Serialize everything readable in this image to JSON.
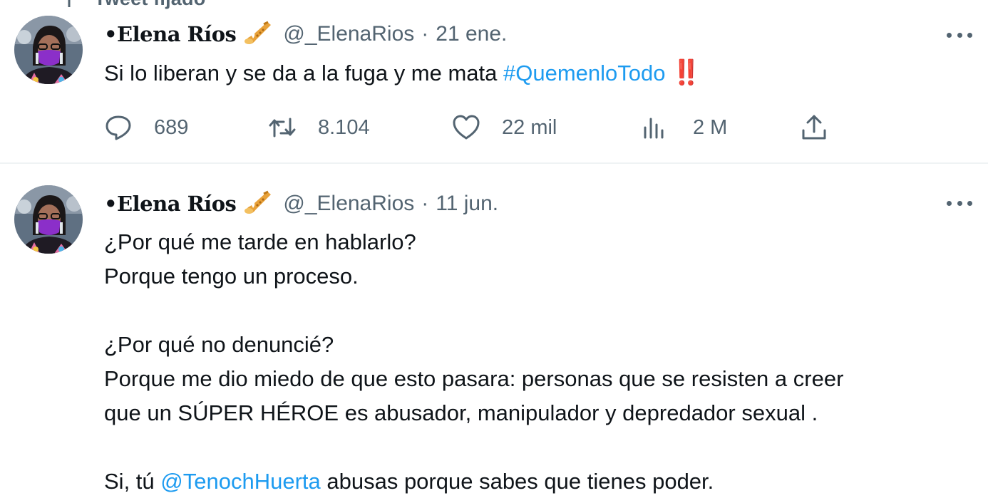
{
  "pinned": {
    "label": "Tweet fijado"
  },
  "tweets": [
    {
      "display_name": "•Elena Ríos",
      "handle": "@_ElenaRios",
      "separator": "·",
      "date": "21 ene.",
      "text": {
        "part1": "Si lo liberan y se da a la fuga y me mata ",
        "hashtag": "#QuemenloTodo",
        "emoji": "‼️"
      },
      "stats": {
        "replies": "689",
        "retweets": "8.104",
        "likes": "22 mil",
        "views": "2 M"
      }
    },
    {
      "display_name": "•Elena Ríos",
      "handle": "@_ElenaRios",
      "separator": "·",
      "date": "11 jun.",
      "lines": [
        "¿Por qué me tarde en hablarlo?",
        "Porque tengo un proceso.",
        "",
        "¿Por qué no denuncié?",
        "Porque me dio miedo de que esto pasara: personas que se resisten a creer",
        "que un SÚPER HÉROE es abusador, manipulador y depredador sexual .",
        ""
      ],
      "last_line": {
        "prefix": "Si, tú ",
        "mention": "@TenochHuerta",
        "suffix": " abusas porque sabes que tienes poder."
      }
    }
  ],
  "icons": {
    "pin": "pin-icon",
    "name_emoji": "saxophone-emoji-icon",
    "more": "more-options-icon",
    "reply": "reply-icon",
    "retweet": "retweet-icon",
    "like": "heart-icon",
    "views": "views-icon",
    "share": "share-icon"
  },
  "colors": {
    "text": "#0f1419",
    "secondary": "#536471",
    "link": "#1d9bf0",
    "divider": "#eff3f4"
  }
}
